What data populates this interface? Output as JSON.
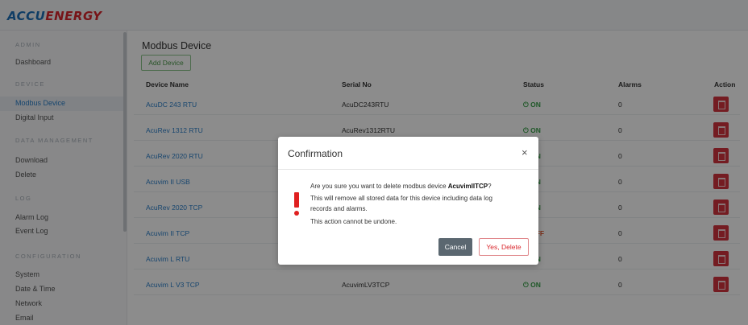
{
  "brand": {
    "logo_part1": "ACCU",
    "logo_part2": "ENERGY"
  },
  "sidebar": {
    "sections": [
      {
        "heading": "ADMIN",
        "items": [
          {
            "label": "Dashboard"
          }
        ]
      },
      {
        "heading": "DEVICE",
        "items": [
          {
            "label": "Modbus Device",
            "active": true
          },
          {
            "label": "Digital Input"
          }
        ]
      },
      {
        "heading": "DATA MANAGEMENT",
        "items": [
          {
            "label": "Download"
          },
          {
            "label": "Delete"
          }
        ]
      },
      {
        "heading": "LOG",
        "items": [
          {
            "label": "Alarm Log"
          },
          {
            "label": "Event Log"
          }
        ]
      },
      {
        "heading": "CONFIGURATION",
        "items": [
          {
            "label": "System"
          },
          {
            "label": "Date & Time"
          },
          {
            "label": "Network"
          },
          {
            "label": "Email"
          }
        ]
      }
    ]
  },
  "main": {
    "title": "Modbus Device",
    "add_button": "Add Device",
    "columns": [
      "Device Name",
      "Serial No",
      "Status",
      "Alarms",
      "Action"
    ],
    "rows": [
      {
        "name": "AcuDC 243 RTU",
        "serial": "AcuDC243RTU",
        "status": "ON",
        "alarms": "0"
      },
      {
        "name": "AcuRev 1312 RTU",
        "serial": "AcuRev1312RTU",
        "status": "ON",
        "alarms": "0"
      },
      {
        "name": "AcuRev 2020 RTU",
        "serial": "",
        "status": "ON",
        "alarms": "0"
      },
      {
        "name": "Acuvim II USB",
        "serial": "",
        "status": "ON",
        "alarms": "0"
      },
      {
        "name": "AcuRev 2020 TCP",
        "serial": "",
        "status": "ON",
        "alarms": "0"
      },
      {
        "name": "Acuvim II TCP",
        "serial": "",
        "status": "OFF",
        "alarms": "0"
      },
      {
        "name": "Acuvim L RTU",
        "serial": "",
        "status": "ON",
        "alarms": "0"
      },
      {
        "name": "Acuvim L V3 TCP",
        "serial": "AcuvimLV3TCP",
        "status": "ON",
        "alarms": "0"
      }
    ]
  },
  "modal": {
    "title": "Confirmation",
    "close": "×",
    "question_prefix": "Are you sure you want to delete modbus device ",
    "device": "AcuvimIITCP",
    "question_suffix": "?",
    "warning_line1": "This will remove all stored data for this device including data log",
    "warning_line2": "records and alarms.",
    "undone": "This action cannot be undone.",
    "cancel": "Cancel",
    "confirm": "Yes, Delete"
  },
  "colors": {
    "accent": "#2a7fc9",
    "danger": "#d3333f",
    "success": "#3aa14a",
    "off": "#e0552c"
  }
}
